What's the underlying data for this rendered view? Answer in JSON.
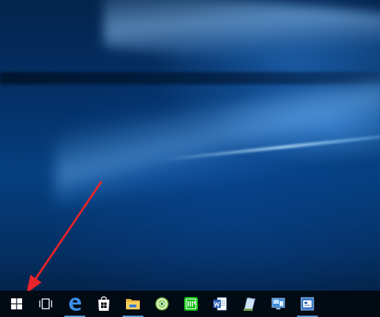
{
  "desktop": {
    "wallpaper": "windows-10-hero",
    "accent_color": "#0a4fa0"
  },
  "annotation": {
    "arrow_color": "#e8242a",
    "points_to": "start-button"
  },
  "taskbar": {
    "background": "#020a14",
    "items": [
      {
        "name": "start-button",
        "icon": "windows-logo-icon"
      },
      {
        "name": "task-view-button",
        "icon": "task-view-icon"
      },
      {
        "name": "edge-button",
        "icon": "edge-icon"
      },
      {
        "name": "store-button",
        "icon": "store-icon"
      },
      {
        "name": "file-explorer-button",
        "icon": "folder-icon"
      },
      {
        "name": "browser-green-button",
        "icon": "green-globe-icon"
      },
      {
        "name": "iqiyi-button",
        "icon": "iqiyi-icon"
      },
      {
        "name": "word-button",
        "icon": "word-icon"
      },
      {
        "name": "app-blue-button",
        "icon": "notepad-app-icon"
      },
      {
        "name": "remote-desktop-button",
        "icon": "remote-desktop-icon"
      },
      {
        "name": "app-window-button",
        "icon": "window-app-icon"
      }
    ]
  }
}
